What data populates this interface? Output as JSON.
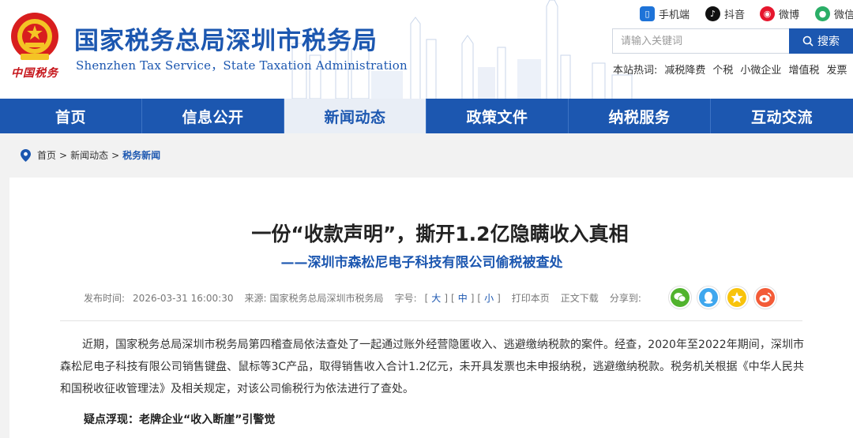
{
  "header": {
    "title": "国家税务总局深圳市税务局",
    "subtitle": "Shenzhen Tax Service，State Taxation Administration",
    "seal_text": "中国税务",
    "social": [
      {
        "label": "手机端",
        "icon": "mobile-icon"
      },
      {
        "label": "抖音",
        "icon": "douyin-icon"
      },
      {
        "label": "微博",
        "icon": "weibo-icon"
      },
      {
        "label": "微信",
        "icon": "wechat-icon"
      }
    ],
    "search": {
      "placeholder": "请输入关键词",
      "button_label": "搜索"
    },
    "hot_words": {
      "label": "本站热词:",
      "items": [
        "减税降费",
        "个税",
        "小微企业",
        "增值税",
        "发票"
      ]
    }
  },
  "nav": {
    "items": [
      "首页",
      "信息公开",
      "新闻动态",
      "政策文件",
      "纳税服务",
      "互动交流"
    ],
    "active": "新闻动态"
  },
  "breadcrumb": {
    "home": "首页",
    "sep": ">",
    "level1": "新闻动态",
    "current": "税务新闻"
  },
  "article": {
    "title": "一份“收款声明”，撕开1.2亿隐瞒收入真相",
    "subtitle": "——深圳市森松尼电子科技有限公司偷税被查处",
    "meta": {
      "publish_label": "发布时间:",
      "publish_time": "2026-03-31 16:00:30",
      "source_label": "来源:",
      "source": "国家税务总局深圳市税务局",
      "fontsize_label": "字号:",
      "font_large": "大",
      "font_medium": "中",
      "font_small": "小",
      "print": "打印本页",
      "download": "正文下载",
      "share_label": "分享到:"
    },
    "share_targets": [
      "wechat-icon",
      "qq-icon",
      "qzone-icon",
      "weibo-icon"
    ],
    "paragraph1": "近期，国家税务总局深圳市税务局第四稽查局依法查处了一起通过账外经营隐匿收入、逃避缴纳税款的案件。经查，2020年至2022年期间，深圳市森松尼电子科技有限公司销售键盘、鼠标等3C产品，取得销售收入合计1.2亿元，未开具发票也未申报纳税，逃避缴纳税款。税务机关根据《中华人民共和国税收征收管理法》及相关规定，对该公司偷税行为依法进行了查处。",
    "section1_heading": "疑点浮现：老牌企业“收入断崖”引警觉"
  },
  "colors": {
    "brand_blue": "#1c57b0",
    "seal_red": "#c6151b"
  }
}
